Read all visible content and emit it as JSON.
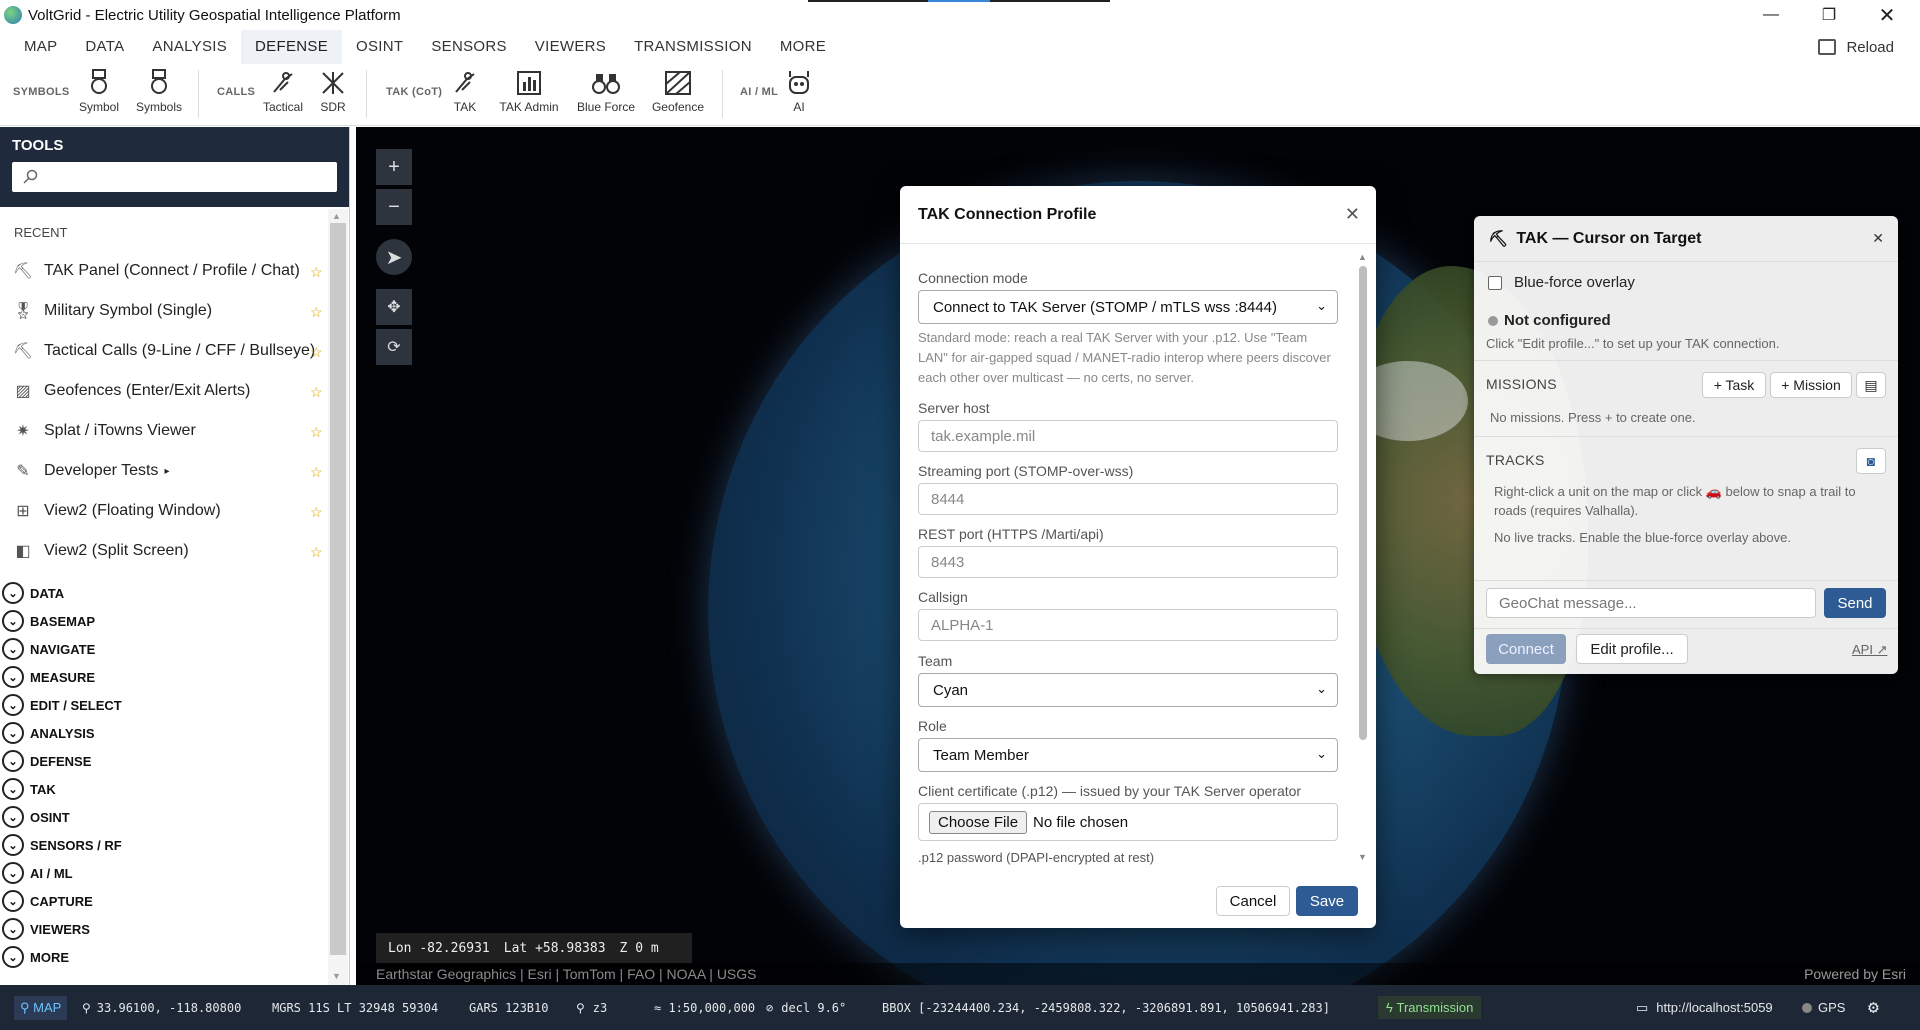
{
  "window": {
    "title": "VoltGrid - Electric Utility Geospatial Intelligence Platform"
  },
  "menu": {
    "tabs": [
      "MAP",
      "DATA",
      "ANALYSIS",
      "DEFENSE",
      "OSINT",
      "SENSORS",
      "VIEWERS",
      "TRANSMISSION",
      "MORE"
    ],
    "active": "DEFENSE",
    "reload_label": "Reload"
  },
  "ribbon": {
    "groups": [
      "SYMBOLS",
      "CALLS",
      "TAK (CoT)",
      "AI / ML"
    ],
    "buttons": [
      "Symbol",
      "Symbols",
      "Tactical",
      "SDR",
      "TAK",
      "TAK Admin",
      "Blue Force",
      "Geofence",
      "AI"
    ]
  },
  "sidebar": {
    "title": "TOOLS",
    "search_placeholder": "",
    "recent_label": "RECENT",
    "recent": [
      "TAK Panel (Connect / Profile / Chat)",
      "Military Symbol (Single)",
      "Tactical Calls (9-Line / CFF / Bullseye)",
      "Geofences (Enter/Exit Alerts)",
      "Splat / iTowns Viewer",
      "Developer Tests",
      "View2 (Floating Window)",
      "View2 (Split Screen)"
    ],
    "categories": [
      "DATA",
      "BASEMAP",
      "NAVIGATE",
      "MEASURE",
      "EDIT / SELECT",
      "ANALYSIS",
      "DEFENSE",
      "TAK",
      "OSINT",
      "SENSORS / RF",
      "AI / ML",
      "CAPTURE",
      "VIEWERS",
      "MORE"
    ]
  },
  "map": {
    "lon_label": "Lon",
    "lon": "-82.26931",
    "lat_label": "Lat",
    "lat": "+58.98383",
    "z_label": "Z",
    "z": "0 m",
    "attribution": "Earthstar Geographics | Esri | TomTom | FAO | NOAA | USGS",
    "powered": "Powered by Esri"
  },
  "modal": {
    "title": "TAK Connection Profile",
    "connection_mode_label": "Connection mode",
    "connection_mode_value": "Connect to TAK Server (STOMP / mTLS wss :8444)",
    "help_text": "Standard mode: reach a real TAK Server with your .p12. Use \"Team LAN\" for air-gapped squad / MANET-radio interop where peers discover each other over multicast — no certs, no server.",
    "server_host_label": "Server host",
    "server_host_placeholder": "tak.example.mil",
    "streaming_port_label": "Streaming port (STOMP-over-wss)",
    "streaming_port_placeholder": "8444",
    "rest_port_label": "REST port (HTTPS /Marti/api)",
    "rest_port_placeholder": "8443",
    "callsign_label": "Callsign",
    "callsign_placeholder": "ALPHA-1",
    "team_label": "Team",
    "team_value": "Cyan",
    "role_label": "Role",
    "role_value": "Team Member",
    "cert_label": "Client certificate (.p12) — issued by your TAK Server operator",
    "choose_file": "Choose File",
    "no_file": "No file chosen",
    "p12_password_label": ".p12 password (DPAPI-encrypted at rest)",
    "cancel": "Cancel",
    "save": "Save"
  },
  "tak_panel": {
    "title": "TAK — Cursor on Target",
    "blue_force_label": "Blue-force overlay",
    "status": "Not configured",
    "status_hint": "Click \"Edit profile...\" to set up your TAK connection.",
    "missions_label": "MISSIONS",
    "task_btn": "+ Task",
    "mission_btn": "+ Mission",
    "missions_empty": "No missions. Press + to create one.",
    "tracks_label": "TRACKS",
    "tracks_help_1": "Right-click a unit on the map or click",
    "tracks_help_2": "below to snap a trail to roads (requires Valhalla).",
    "tracks_empty": "No live tracks. Enable the blue-force overlay above.",
    "chat_placeholder": "GeoChat message...",
    "send": "Send",
    "connect": "Connect",
    "edit_profile": "Edit profile...",
    "api": "API ↗"
  },
  "status": {
    "map": "MAP",
    "latlon": "33.96100, -118.80800",
    "mgrs": "MGRS 11S LT 32948 59304",
    "gars": "GARS 123B10",
    "zoom": "z3",
    "scale": "≈ 1:50,000,000",
    "decl": "decl 9.6°",
    "bbox": "BBOX [-23244400.234, -2459808.322, -3206891.891, 10506941.283]",
    "transmission": "Transmission",
    "url": "http://localhost:5059",
    "gps": "GPS"
  }
}
